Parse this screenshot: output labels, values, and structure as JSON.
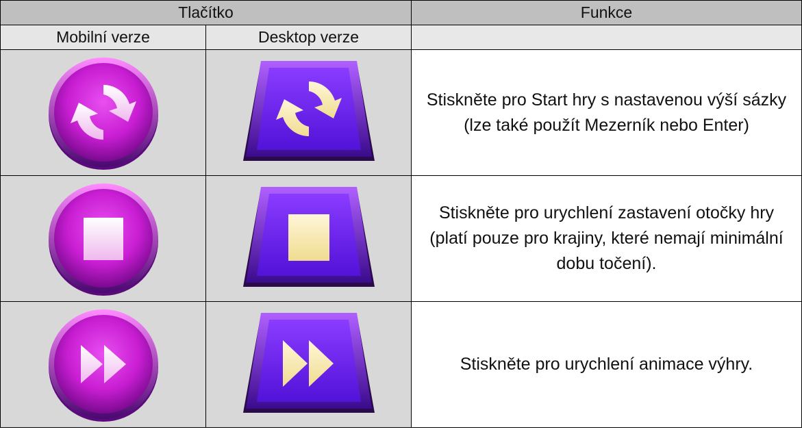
{
  "table": {
    "header": {
      "button_col": "Tlačítko",
      "function_col": "Funkce",
      "mobile_col": "Mobilní verze",
      "desktop_col": "Desktop verze",
      "empty": ""
    },
    "rows": [
      {
        "icon": "refresh-icon",
        "description": "Stiskněte pro Start hry s nastavenou výší sázky (lze také použít Mezerník nebo Enter)"
      },
      {
        "icon": "stop-icon",
        "description": "Stiskněte pro urychlení zastavení otočky hry (platí pouze pro krajiny, které nemají minimální dobu točení)."
      },
      {
        "icon": "fast-forward-icon",
        "description": "Stiskněte pro urychlení animace výhry."
      }
    ]
  },
  "colors": {
    "mobile_button": "#d21fd8",
    "desktop_button": "#6a17e8",
    "mobile_symbol": "#f6d6f4",
    "desktop_symbol": "#f4e6b4",
    "header_bg": "#bfbfbf",
    "icon_cell_bg": "#d8d8d8"
  }
}
